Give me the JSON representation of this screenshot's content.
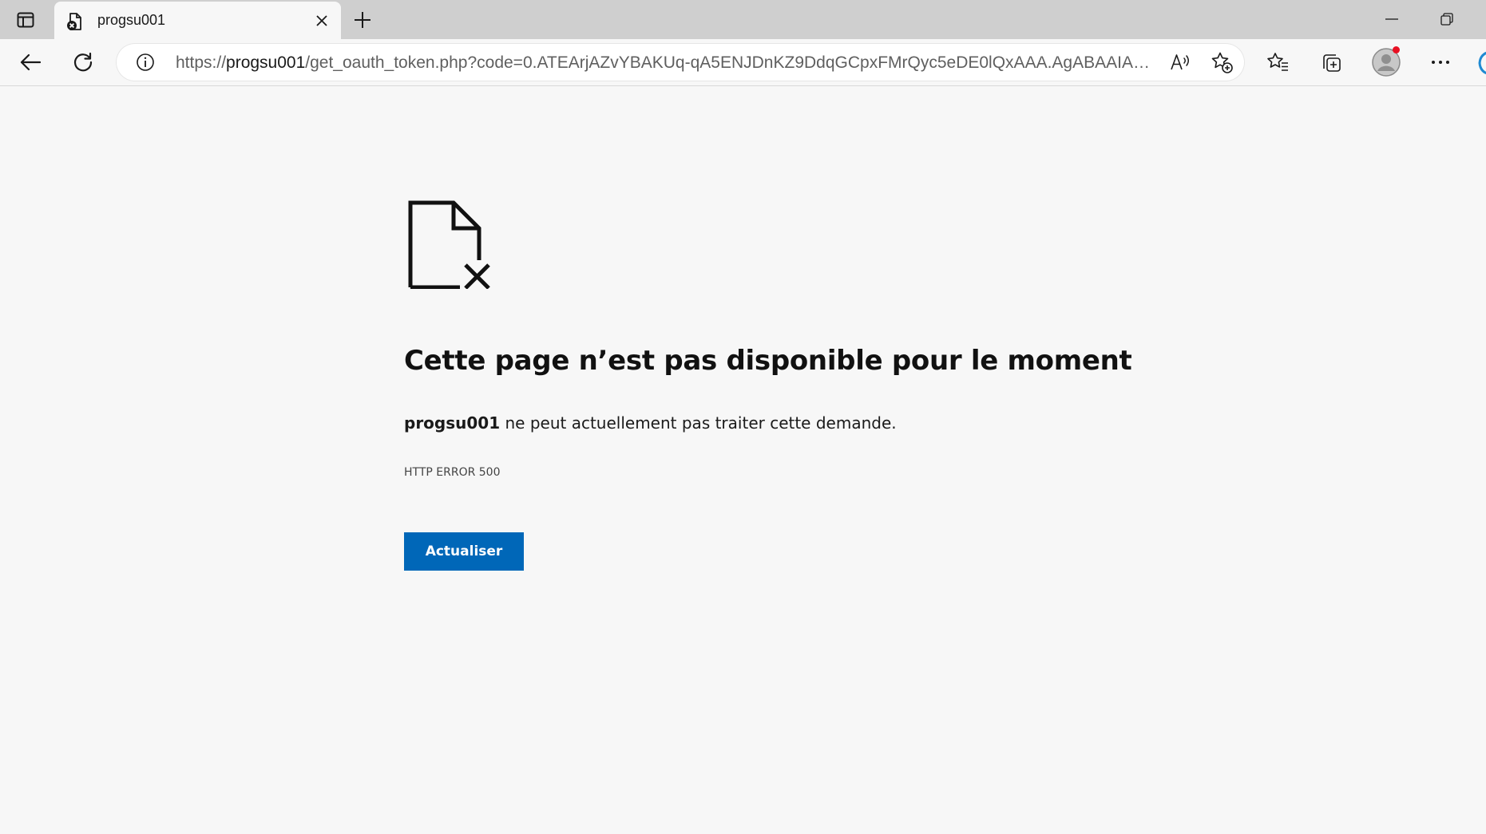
{
  "tab": {
    "title": "progsu001"
  },
  "address_bar": {
    "url_prefix": "https://",
    "url_host": "progsu001",
    "url_path": "/get_oauth_token.php?code=0.ATEArjAZvYBAKUq-qA5ENJDnKZ9DdqGCpxFMrQyc5eDE0lQxAAA.AgABAAIAAAD..."
  },
  "error": {
    "title": "Cette page n’est pas disponible pour le moment",
    "host": "progsu001",
    "message_suffix": " ne peut actuellement pas traiter cette demande.",
    "code": "HTTP ERROR 500",
    "refresh_label": "Actualiser"
  },
  "colors": {
    "accent": "#0067b8",
    "notification_dot": "#e81123",
    "page_background": "#f7f7f7",
    "tabstrip_background": "#cfcfcf"
  },
  "icons": {
    "tab_actions": "tab-actions-icon",
    "favicon": "error-page-favicon",
    "tab_close": "close-icon",
    "new_tab": "plus-icon",
    "minimize": "minimize-icon",
    "restore": "restore-icon",
    "back": "back-arrow-icon",
    "reload": "reload-icon",
    "site_info": "info-icon",
    "read_aloud": "read-aloud-icon",
    "add_favorite": "add-favorite-icon",
    "favorites": "favorites-icon",
    "collections": "collections-icon",
    "profile": "profile-avatar-icon",
    "more": "more-icon",
    "error": "broken-document-icon"
  }
}
